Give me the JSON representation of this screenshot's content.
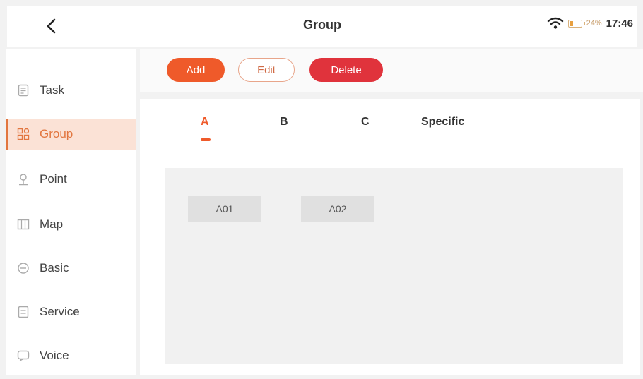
{
  "header": {
    "back_icon": "chevron-left-icon",
    "title": "Group",
    "wifi_icon": "wifi-icon",
    "battery_percent": "24%",
    "time": "17:46"
  },
  "sidebar": {
    "items": [
      {
        "label": "Task",
        "icon": "task-icon",
        "active": false
      },
      {
        "label": "Group",
        "icon": "group-icon",
        "active": true
      },
      {
        "label": "Point",
        "icon": "point-icon",
        "active": false
      },
      {
        "label": "Map",
        "icon": "map-icon",
        "active": false
      },
      {
        "label": "Basic",
        "icon": "basic-icon",
        "active": false
      },
      {
        "label": "Service",
        "icon": "service-icon",
        "active": false
      },
      {
        "label": "Voice",
        "icon": "voice-icon",
        "active": false
      }
    ]
  },
  "toolbar": {
    "add_label": "Add",
    "edit_label": "Edit",
    "delete_label": "Delete"
  },
  "tabs": [
    {
      "label": "A",
      "active": true
    },
    {
      "label": "B",
      "active": false
    },
    {
      "label": "C",
      "active": false
    },
    {
      "label": "Specific",
      "active": false
    }
  ],
  "points": [
    "A01",
    "A02"
  ],
  "colors": {
    "accent": "#ef5a2a",
    "delete": "#e0333c",
    "active_bg": "#fbe2d6"
  }
}
